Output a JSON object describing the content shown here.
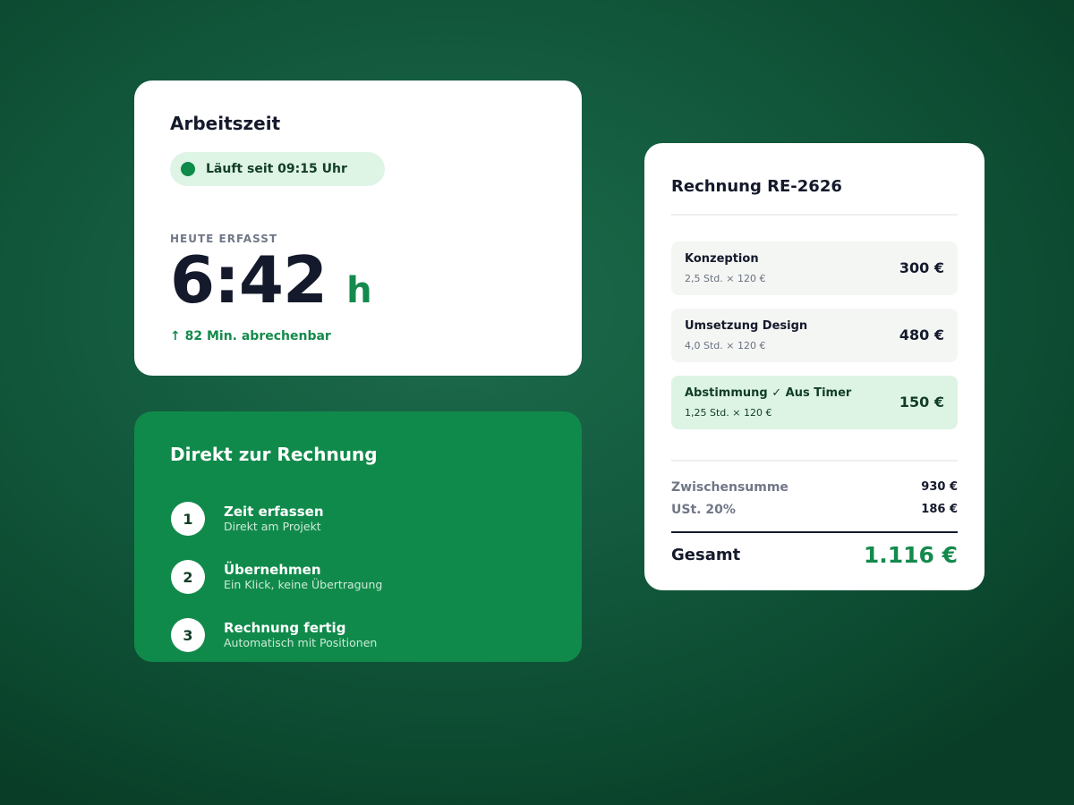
{
  "time_card": {
    "title": "Arbeitszeit",
    "status": "Läuft seit 09:15 Uhr",
    "today_label": "HEUTE ERFASST",
    "hours_value": "6:42",
    "hours_unit": "h",
    "billable": "↑ 82 Min. abrechenbar"
  },
  "steps_card": {
    "title": "Direkt zur Rechnung",
    "steps": [
      {
        "num": "1",
        "title": "Zeit erfassen",
        "sub": "Direkt am Projekt"
      },
      {
        "num": "2",
        "title": "Übernehmen",
        "sub": "Ein Klick, keine Übertragung"
      },
      {
        "num": "3",
        "title": "Rechnung fertig",
        "sub": "Automatisch mit Positionen"
      }
    ]
  },
  "invoice": {
    "title": "Rechnung RE-2626",
    "items": [
      {
        "name": "Konzeption",
        "detail": "2,5 Std. × 120 €",
        "amount": "300 €"
      },
      {
        "name": "Umsetzung Design",
        "detail": "4,0 Std. × 120 €",
        "amount": "480 €"
      },
      {
        "name": "Abstimmung ✓ Aus Timer",
        "detail": "1,25 Std. × 120 €",
        "amount": "150 €"
      }
    ],
    "subtotal_label": "Zwischensumme",
    "subtotal_value": "930 €",
    "vat_label": "USt. 20%",
    "vat_value": "186 €",
    "total_label": "Gesamt",
    "total_value": "1.116 €"
  },
  "colors": {
    "accent": "#148a4d",
    "dark_card": "#108a4b",
    "background": "#135a3e"
  }
}
